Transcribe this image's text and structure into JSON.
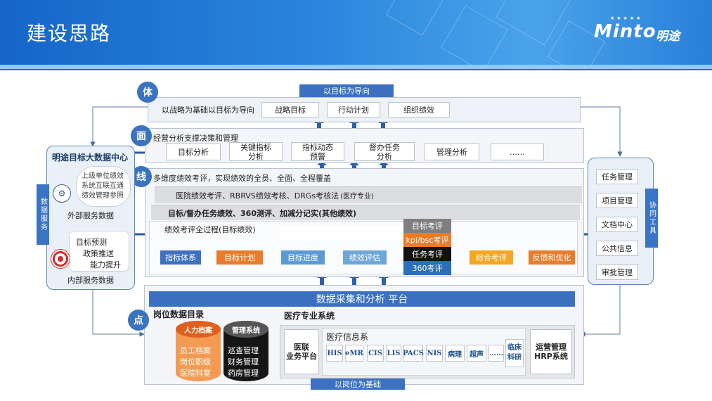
{
  "header": {
    "title": "建设思路",
    "logo_text": "Minto",
    "logo_cn": "明途",
    "logo_stars": "★★★★★"
  },
  "ti": {
    "circle": "体",
    "top_banner": "以目标为导向",
    "desc": "以战略为基础以目标为导向",
    "items": [
      "战略目标",
      "行动计划",
      "组织绩效"
    ]
  },
  "mian": {
    "circle": "面",
    "desc": "经营分析支撑决策和管理",
    "items": [
      "目标分析",
      "关键指标\n分析",
      "指标动态\n预警",
      "督办任务\n分析",
      "管理分析",
      "……"
    ]
  },
  "xian": {
    "circle": "线",
    "desc": "多维度绩效考评，实现绩效的全员、全面、全程覆盖",
    "row1": "医院绩效考评、RBRVS绩效考核、DRGs考核法",
    "row1_note": "(医疗专业)",
    "row2": "目标/督办任务绩效、360测评、加减分记实(其他绩效)",
    "process_title": "绩效考评全过程(目标绩效)",
    "flow": [
      "指标体系",
      "目标计划",
      "目标进度",
      "绩效评估",
      "综合考评",
      "反馈和优化"
    ],
    "stack": [
      "目标考评",
      "kpi/bsc考评",
      "任务考评",
      "360考评"
    ]
  },
  "platform": "数据采集和分析 平台",
  "dian": {
    "circle": "点",
    "catalog_title": "岗位数据目录",
    "hr_title": "人力档案",
    "hr_items": [
      "员工档案",
      "岗位职级",
      "医院科室"
    ],
    "mgmt_title": "管理系统",
    "mgmt_items": [
      "巡查管理",
      "财务管理",
      "药房管理"
    ],
    "medical_title": "医疗专业系统",
    "yilian": "医联\n业务平台",
    "info_title": "医疗信息系",
    "systems": [
      "HIS",
      "eMR",
      "CIS",
      "LIS",
      "PACS",
      "NIS",
      "病理",
      "超声",
      "……",
      "临床\n科研"
    ],
    "hrp": "运营管理\nHRP系统",
    "bottom_banner": "以岗位为基础"
  },
  "left": {
    "title": "明途目标大数据中心",
    "side_tag": "数据服务",
    "cloud_text": "上级单位绩效\n系统互联互通\n绩效管理参照",
    "external_label": "外部服务数据",
    "internal_text": [
      "目标预测",
      "政策推送",
      "能力提升"
    ],
    "internal_label": "内部服务数据"
  },
  "right": {
    "items": [
      "任务管理",
      "项目管理",
      "文档中心",
      "公共信息",
      "审批管理"
    ],
    "side_tag": "协同工具"
  },
  "colors": {
    "primary_blue": "#3b71c0",
    "orange": "#e97c2a",
    "light_blue": "#5b9bd5",
    "black": "#111111",
    "grey": "#7f7f7f"
  }
}
